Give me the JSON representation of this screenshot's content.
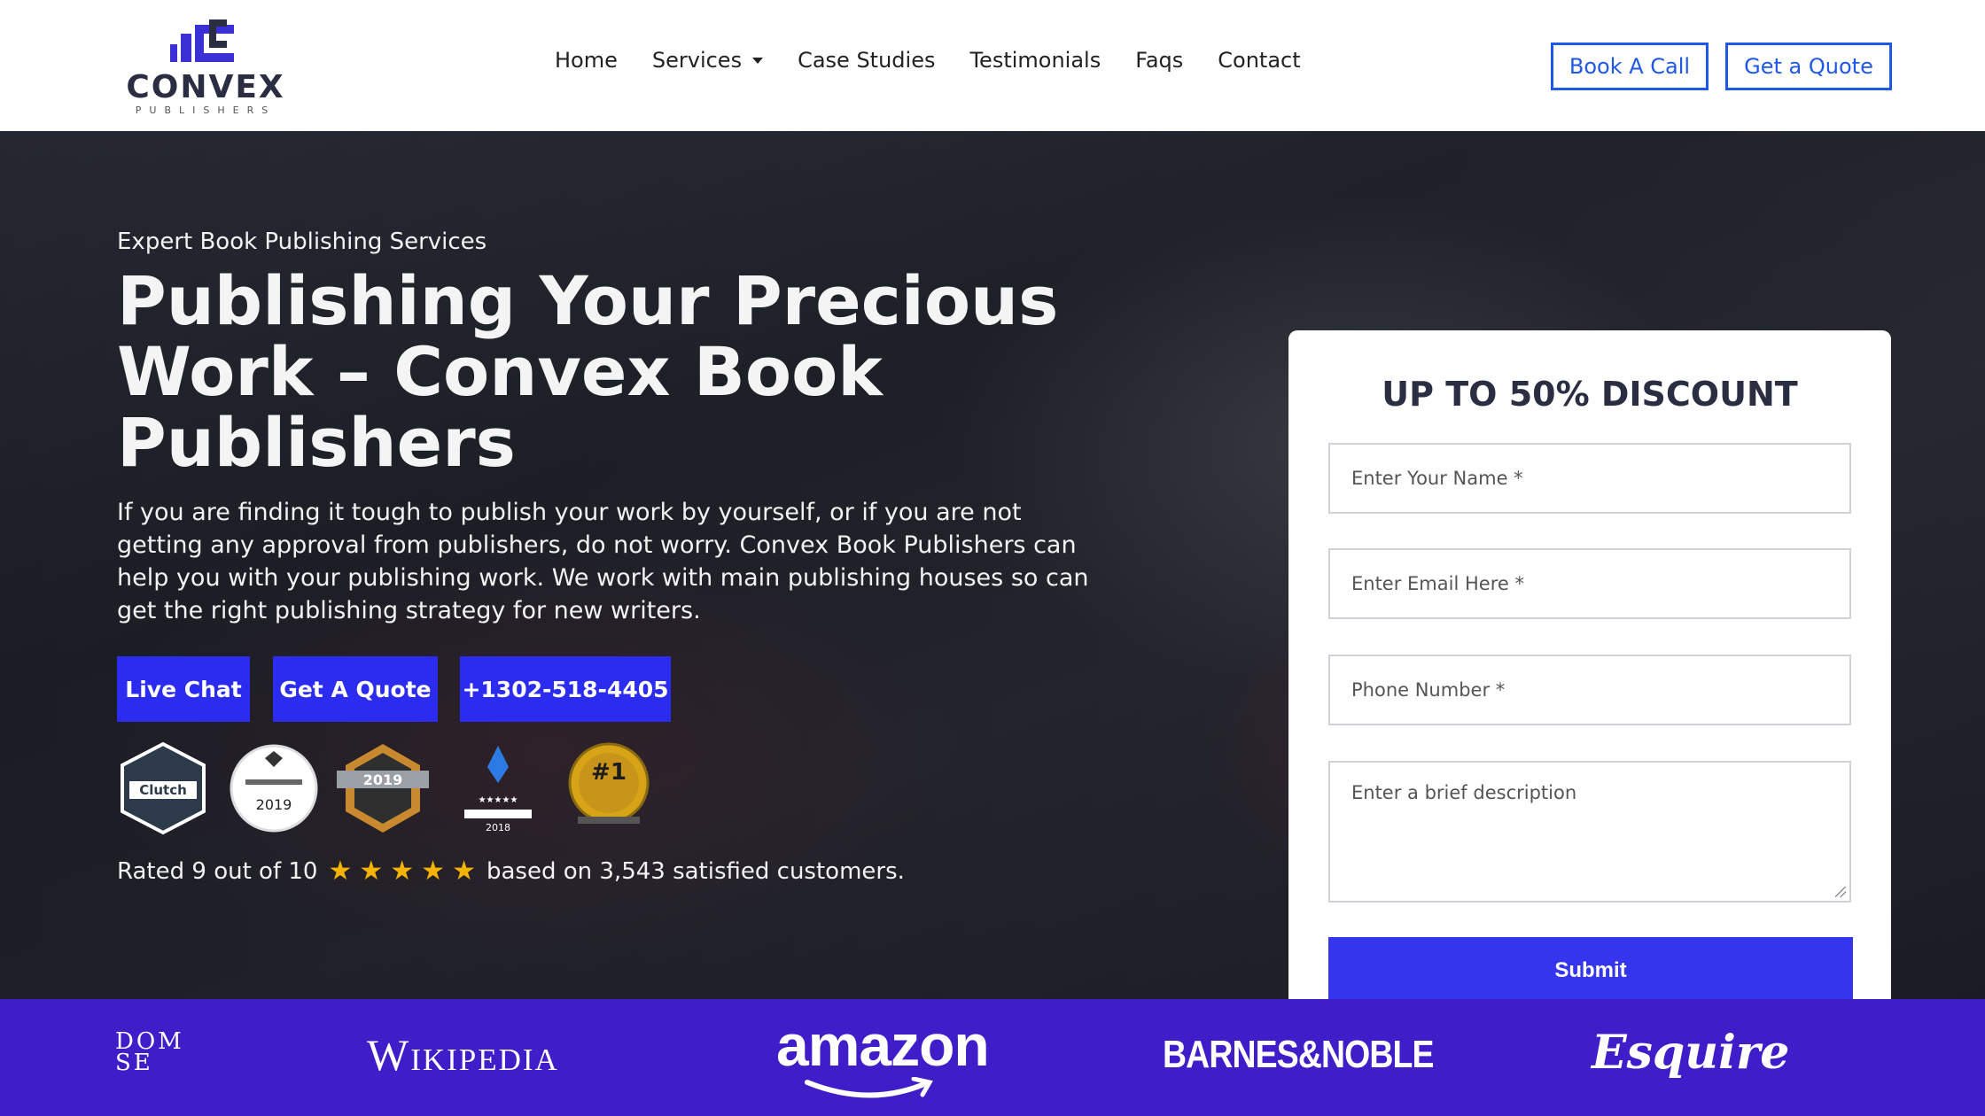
{
  "header": {
    "logo": {
      "name": "CONVEX",
      "sub": "PUBLISHERS"
    },
    "nav": [
      {
        "label": "Home"
      },
      {
        "label": "Services",
        "has_dropdown": true
      },
      {
        "label": "Case Studies"
      },
      {
        "label": "Testimonials"
      },
      {
        "label": "Faqs"
      },
      {
        "label": "Contact"
      }
    ],
    "book_call_label": "Book A Call",
    "get_quote_label": "Get a Quote",
    "accent_color": "#1f57e6"
  },
  "hero": {
    "eyebrow": "Expert Book Publishing Services",
    "title": "Publishing Your Precious Work – Convex Book Publishers",
    "description": "If you are finding it tough to publish your work by yourself, or if you are not getting any approval from publishers, do not worry. Convex Book Publishers can help you with your publishing work. We work with main publishing houses so can get the right publishing strategy for new writers.",
    "buttons": {
      "live_chat": "Live Chat",
      "get_quote": "Get A Quote",
      "phone": "+1302-518-4405"
    },
    "badges": [
      {
        "icon": "clutch-badge-icon",
        "text": "Clutch"
      },
      {
        "icon": "top-content-marketing-badge-icon",
        "text": "2019"
      },
      {
        "icon": "best-content-seo-badge-icon",
        "text": "2019"
      },
      {
        "icon": "best-content-marketing-agency-badge-icon",
        "text": "2018"
      },
      {
        "icon": "number-one-seo-badge-icon",
        "text": "#1"
      }
    ],
    "rating": {
      "prefix": "Rated 9 out of 10",
      "stars": 5,
      "suffix": "based on 3,543 satisfied customers."
    },
    "cta_color": "#2c2cf0"
  },
  "form": {
    "title": "UP TO 50% DISCOUNT",
    "name_placeholder": "Enter Your Name *",
    "email_placeholder": "Enter Email Here *",
    "phone_placeholder": "Phone Number *",
    "description_placeholder": "Enter a brief description",
    "submit_label": "Submit",
    "submit_color": "#3535ee"
  },
  "brands": {
    "background": "#3f1ec9",
    "items": [
      "DOM SE",
      "Wikipedia",
      "amazon",
      "BARNES&NOBLE",
      "Esquire"
    ]
  }
}
